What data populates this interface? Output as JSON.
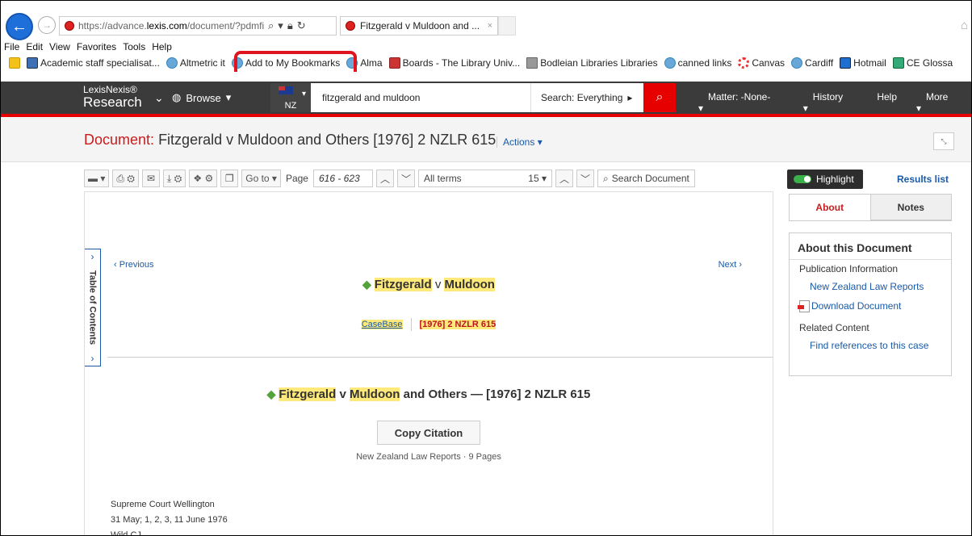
{
  "browser": {
    "url_prefix": "https://advance.",
    "url_host": "lexis.com",
    "url_rest": "/document/?pdmfic",
    "tab_title": "Fitzgerald v Muldoon and ...",
    "tab_close": "×"
  },
  "menu": [
    "File",
    "Edit",
    "View",
    "Favorites",
    "Tools",
    "Help"
  ],
  "favorites": [
    {
      "label": "",
      "icon": "star-icon"
    },
    {
      "label": "Academic staff specialisat...",
      "icon": "shield-icon"
    },
    {
      "label": "Altmetric it",
      "icon": "ie-icon"
    },
    {
      "label": "Add to My Bookmarks",
      "icon": "ie-icon"
    },
    {
      "label": "Alma",
      "icon": "ie-icon"
    },
    {
      "label": "Boards - The Library Univ...",
      "icon": "boards-icon"
    },
    {
      "label": "Bodleian Libraries Libraries",
      "icon": "bodleian-icon"
    },
    {
      "label": "canned links",
      "icon": "ie-icon"
    },
    {
      "label": "Canvas",
      "icon": "canvas-icon"
    },
    {
      "label": "Cardiff",
      "icon": "ie-icon"
    },
    {
      "label": "Hotmail",
      "icon": "outlook-icon"
    },
    {
      "label": "CE Glossa",
      "icon": "ce-icon"
    }
  ],
  "lexis": {
    "brand_line1": "LexisNexis®",
    "brand_line2": "Research",
    "browse": "Browse",
    "jurisdiction": "NZ",
    "query": "fitzgerald and muldoon",
    "scope": "Search: Everything",
    "matter": "Matter: -None-",
    "history": "History",
    "help": "Help",
    "more": "More"
  },
  "document": {
    "label": "Document:",
    "title": "Fitzgerald v Muldoon and Others [1976] 2 NZLR 615",
    "actions": "Actions"
  },
  "toolbar": {
    "goto": "Go to",
    "page_label": "Page",
    "page_value": "616 - 623",
    "terms": "All terms",
    "terms_count": "15",
    "search_doc": "Search Document",
    "highlight": "Highlight",
    "results_list": "Results list"
  },
  "content": {
    "toc": "Table of Contents",
    "previous": "Previous",
    "next": "Next",
    "party1": "Fitzgerald",
    "v": "v",
    "party2": "Muldoon",
    "casebase": "CaseBase",
    "citation": "[1976] 2 NZLR 615",
    "full_rest": "and Others — [1976] 2 NZLR 615",
    "copy_citation": "Copy Citation",
    "pages": "New Zealand Law Reports · 9 Pages",
    "court": "Supreme Court Wellington",
    "dates": "31 May; 1, 2, 3, 11 June 1976",
    "judge": "Wild CJ"
  },
  "panel": {
    "tab_about": "About",
    "tab_notes": "Notes",
    "heading": "About this Document",
    "pub_info": "Publication Information",
    "pub_link": "New Zealand Law Reports",
    "download": "Download Document",
    "related": "Related Content",
    "find_refs": "Find references to this case"
  },
  "colors": {
    "accent_red": "#e60000",
    "nav_bg": "#3b3b3b",
    "link_blue": "#1a5aa6",
    "highlight_yellow": "#ffe97a",
    "annotation_red": "#e0141e"
  }
}
